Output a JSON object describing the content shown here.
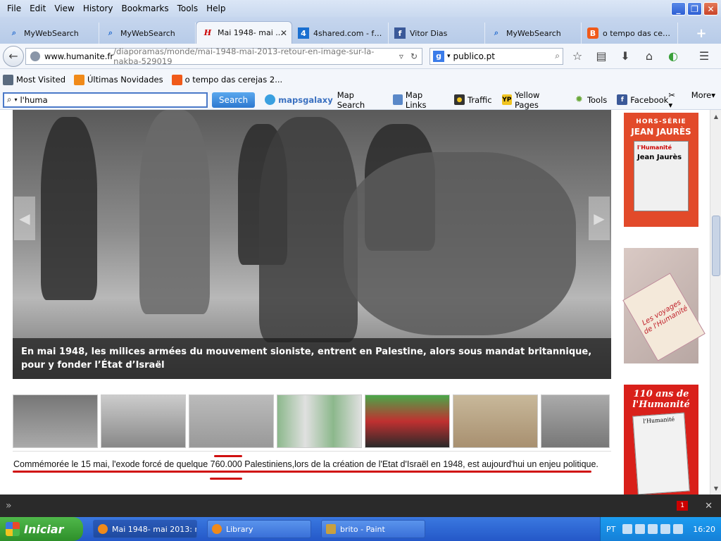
{
  "menu": [
    "File",
    "Edit",
    "View",
    "History",
    "Bookmarks",
    "Tools",
    "Help"
  ],
  "window_controls": {
    "minimize": "_",
    "restore": "❐",
    "close": "✕"
  },
  "tabs": [
    {
      "label": "MyWebSearch",
      "icon": "search-icon"
    },
    {
      "label": "MyWebSearch",
      "icon": "search-icon"
    },
    {
      "label": "Mai 1948- mai ...",
      "icon": "humanite-h-icon",
      "active": true
    },
    {
      "label": "4shared.com - fre...",
      "icon": "4shared-icon"
    },
    {
      "label": "Vitor Dias",
      "icon": "facebook-icon"
    },
    {
      "label": "MyWebSearch",
      "icon": "search-icon"
    },
    {
      "label": "o tempo das cerej...",
      "icon": "blogger-icon"
    }
  ],
  "newtab_label": "+",
  "nav": {
    "url_host": "www.humanite.fr",
    "url_path": "/diaporamas/monde/mai-1948-mai-2013-retour-en-image-sur-la-nakba-529019",
    "search_value": "publico.pt",
    "search_engine": "g"
  },
  "bookmarks": [
    {
      "label": "Most Visited",
      "icon": "bookmark-icon",
      "color": "#5a6b80"
    },
    {
      "label": "Últimas Novidades",
      "icon": "rss-icon",
      "color": "#f08a1a"
    },
    {
      "label": "o tempo das cerejas 2...",
      "icon": "blogger-icon",
      "color": "#f05a1a"
    }
  ],
  "mws": {
    "input_value": "l'huma",
    "search_label": "Search",
    "brand": "mapsgalaxy",
    "items": [
      {
        "label": "Map Search",
        "icon": "map-search-icon",
        "color": "#3aa0e0"
      },
      {
        "label": "Map Links",
        "icon": "map-links-icon",
        "color": "#5a88c8"
      },
      {
        "label": "Traffic",
        "icon": "traffic-light-icon",
        "color": "#333333"
      },
      {
        "label": "Yellow Pages",
        "icon": "yellow-pages-icon",
        "color": "#f0c420"
      },
      {
        "label": "Tools",
        "icon": "gear-icon",
        "color": "#6aa83a"
      },
      {
        "label": "Facebook",
        "icon": "facebook-icon",
        "color": "#3b5998"
      }
    ],
    "more_label": "More"
  },
  "slideshow": {
    "caption": "En mai 1948, les milices armées du mouvement sioniste, entrent en Palestine, alors sous mandat britannique, pour y fonder l’État d’Israël",
    "prev": "◀",
    "next": "▶"
  },
  "summary_text": "Commémorée le 15 mai, l'exode forcé de quelque 760.000 Palestiniens,lors de la création de l'Etat d'Israël en 1948, est aujourd'hui un enjeu politique.",
  "sidebar": {
    "hors_serie": "HORS-SÉRIE",
    "jaures_name": "JEAN JAURÈS",
    "cover_brand": "l'Humanité",
    "cover_title": "Jean Jaurès",
    "voyages_tag": "Les voyages de l'Humanité",
    "anniversary_title": "110 ans de l'Humanité",
    "paper_brand": "l'Humanité"
  },
  "addon_badge": "1",
  "taskbar": {
    "start_label": "Iniciar",
    "tasks": [
      {
        "label": "Mai 1948- mai 2013: r...",
        "color": "#f08a1a",
        "active": true
      },
      {
        "label": "Library",
        "color": "#f08a1a"
      },
      {
        "label": "brito - Paint",
        "color": "#c8a040"
      }
    ],
    "lang": "PT",
    "clock": "16:20"
  }
}
